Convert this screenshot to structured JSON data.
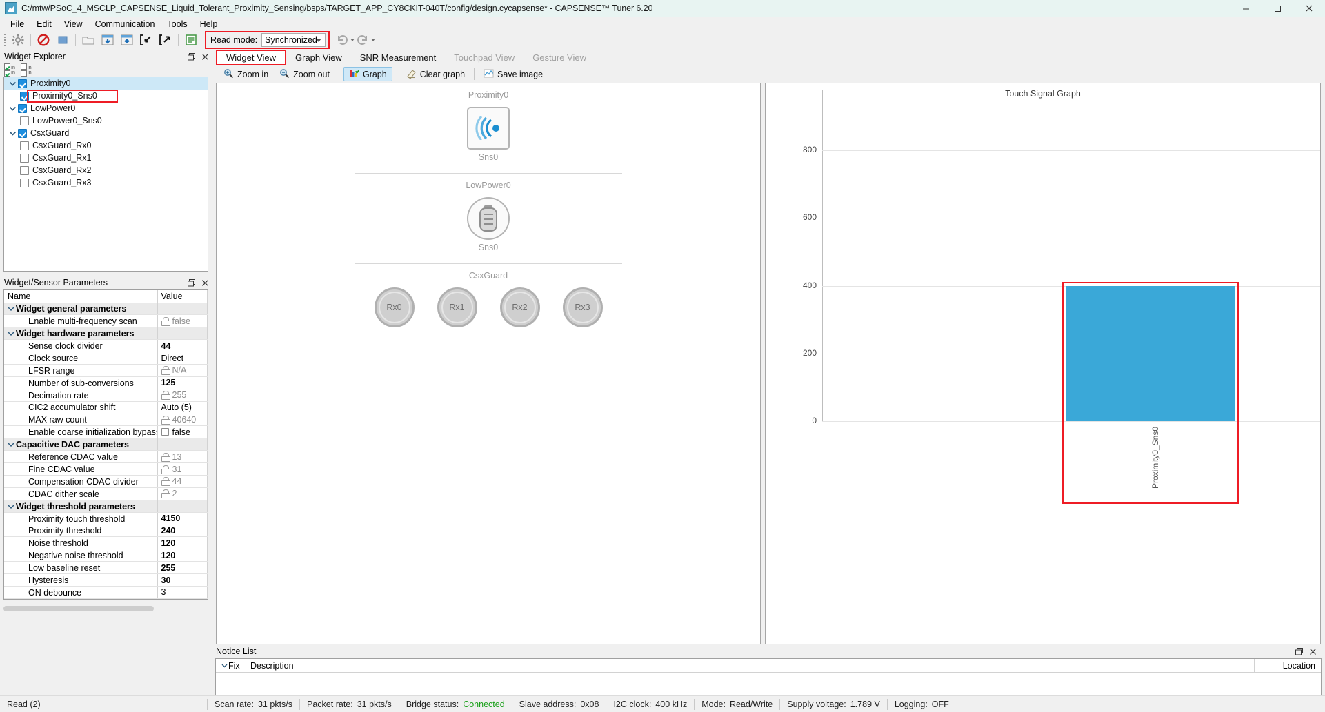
{
  "window": {
    "title": "C:/mtw/PSoC_4_MSCLP_CAPSENSE_Liquid_Tolerant_Proximity_Sensing/bsps/TARGET_APP_CY8CKIT-040T/config/design.cycapsense* - CAPSENSE™ Tuner 6.20",
    "minimize": "–",
    "maximize": "▢",
    "close": "✕"
  },
  "menu": {
    "items": [
      "File",
      "Edit",
      "View",
      "Communication",
      "Tools",
      "Help"
    ]
  },
  "toolbar": {
    "read_mode_label": "Read mode:",
    "read_mode_value": "Synchronized",
    "buttons": [
      "settings-icon",
      "disconnect-icon",
      "stop-icon",
      "open-icon",
      "apply-to-device-icon",
      "apply-to-project-icon",
      "import-icon",
      "export-icon",
      "log-icon"
    ],
    "undo_label": "Undo",
    "redo_label": "Redo"
  },
  "widget_explorer": {
    "title": "Widget Explorer",
    "restore_label": "Restore",
    "close_label": "Close",
    "tree": [
      {
        "label": "Proximity0",
        "level": 0,
        "checked": true,
        "expanded": true,
        "selected": true,
        "highlight": false
      },
      {
        "label": "Proximity0_Sns0",
        "level": 1,
        "checked": true,
        "expanded": null,
        "selected": false,
        "highlight": true
      },
      {
        "label": "LowPower0",
        "level": 0,
        "checked": true,
        "expanded": true,
        "selected": false,
        "highlight": false
      },
      {
        "label": "LowPower0_Sns0",
        "level": 1,
        "checked": false,
        "expanded": null,
        "selected": false,
        "highlight": false
      },
      {
        "label": "CsxGuard",
        "level": 0,
        "checked": true,
        "expanded": true,
        "selected": false,
        "highlight": false
      },
      {
        "label": "CsxGuard_Rx0",
        "level": 1,
        "checked": false,
        "expanded": null,
        "selected": false,
        "highlight": false
      },
      {
        "label": "CsxGuard_Rx1",
        "level": 1,
        "checked": false,
        "expanded": null,
        "selected": false,
        "highlight": false
      },
      {
        "label": "CsxGuard_Rx2",
        "level": 1,
        "checked": false,
        "expanded": null,
        "selected": false,
        "highlight": false
      },
      {
        "label": "CsxGuard_Rx3",
        "level": 1,
        "checked": false,
        "expanded": null,
        "selected": false,
        "highlight": false
      }
    ]
  },
  "parameters": {
    "title": "Widget/Sensor Parameters",
    "columns": [
      "Name",
      "Value"
    ],
    "rows": [
      {
        "kind": "group",
        "name": "Widget general parameters",
        "value": ""
      },
      {
        "kind": "item",
        "name": "Enable multi-frequency scan",
        "value": "false",
        "locked": true,
        "bold": false
      },
      {
        "kind": "group",
        "name": "Widget hardware parameters",
        "value": ""
      },
      {
        "kind": "item",
        "name": "Sense clock divider",
        "value": "44",
        "locked": false,
        "bold": true
      },
      {
        "kind": "item",
        "name": "Clock source",
        "value": "Direct",
        "locked": false,
        "bold": false
      },
      {
        "kind": "item",
        "name": "LFSR range",
        "value": "N/A",
        "locked": true,
        "bold": false
      },
      {
        "kind": "item",
        "name": "Number of sub-conversions",
        "value": "125",
        "locked": false,
        "bold": true
      },
      {
        "kind": "item",
        "name": "Decimation rate",
        "value": "255",
        "locked": true,
        "bold": false
      },
      {
        "kind": "item",
        "name": "CIC2 accumulator shift",
        "value": "Auto (5)",
        "locked": false,
        "bold": false
      },
      {
        "kind": "item",
        "name": "MAX raw count",
        "value": "40640",
        "locked": true,
        "bold": false
      },
      {
        "kind": "item",
        "name": "Enable coarse initialization bypass",
        "value": "false",
        "checkbox": true,
        "locked": false,
        "bold": false
      },
      {
        "kind": "group",
        "name": "Capacitive DAC parameters",
        "value": ""
      },
      {
        "kind": "item",
        "name": "Reference CDAC value",
        "value": "13",
        "locked": true,
        "bold": false
      },
      {
        "kind": "item",
        "name": "Fine CDAC value",
        "value": "31",
        "locked": true,
        "bold": false
      },
      {
        "kind": "item",
        "name": "Compensation CDAC divider",
        "value": "44",
        "locked": true,
        "bold": false
      },
      {
        "kind": "item",
        "name": "CDAC dither scale",
        "value": "2",
        "locked": true,
        "bold": false
      },
      {
        "kind": "group",
        "name": "Widget threshold parameters",
        "value": ""
      },
      {
        "kind": "item",
        "name": "Proximity touch threshold",
        "value": "4150",
        "locked": false,
        "bold": true
      },
      {
        "kind": "item",
        "name": "Proximity threshold",
        "value": "240",
        "locked": false,
        "bold": true
      },
      {
        "kind": "item",
        "name": "Noise threshold",
        "value": "120",
        "locked": false,
        "bold": true
      },
      {
        "kind": "item",
        "name": "Negative noise threshold",
        "value": "120",
        "locked": false,
        "bold": true
      },
      {
        "kind": "item",
        "name": "Low baseline reset",
        "value": "255",
        "locked": false,
        "bold": true
      },
      {
        "kind": "item",
        "name": "Hysteresis",
        "value": "30",
        "locked": false,
        "bold": true
      },
      {
        "kind": "item",
        "name": "ON debounce",
        "value": "3",
        "locked": false,
        "bold": false
      }
    ]
  },
  "tabs": [
    {
      "label": "Widget View",
      "active": true,
      "disabled": false
    },
    {
      "label": "Graph View",
      "active": false,
      "disabled": false
    },
    {
      "label": "SNR Measurement",
      "active": false,
      "disabled": false
    },
    {
      "label": "Touchpad View",
      "active": false,
      "disabled": true
    },
    {
      "label": "Gesture View",
      "active": false,
      "disabled": true
    }
  ],
  "graph_toolbar": [
    {
      "label": "Zoom in",
      "icon": "zoom-in-icon",
      "toggled": false
    },
    {
      "label": "Zoom out",
      "icon": "zoom-out-icon",
      "toggled": false
    },
    {
      "label": "Graph",
      "icon": "graph-icon",
      "toggled": true
    },
    {
      "label": "Clear graph",
      "icon": "clear-graph-icon",
      "toggled": false
    },
    {
      "label": "Save image",
      "icon": "save-image-icon",
      "toggled": false
    }
  ],
  "widget_view": {
    "sections": [
      {
        "title": "Proximity0",
        "icon": "proximity-sensor-icon",
        "sensors": [
          "Sns0"
        ]
      },
      {
        "title": "LowPower0",
        "icon": "battery-icon",
        "sensors": [
          "Sns0"
        ]
      },
      {
        "title": "CsxGuard",
        "icon": "rx-circle-icon",
        "sensors": [
          "Rx0",
          "Rx1",
          "Rx2",
          "Rx3"
        ]
      }
    ]
  },
  "chart_data": {
    "type": "bar",
    "title": "Touch Signal Graph",
    "categories": [
      "Proximity0_Sns0"
    ],
    "values": [
      400
    ],
    "series": [
      {
        "name": "Touch Signal",
        "values": [
          400
        ]
      }
    ],
    "xlabel": "",
    "ylabel": "",
    "ylim": [
      0,
      900
    ],
    "yticks": [
      0,
      200,
      400,
      600,
      800
    ],
    "ytick_labels": [
      "0",
      "200",
      "400",
      "600",
      "800"
    ],
    "grid": true,
    "legend": false,
    "bar_color": "#3aa8d8",
    "highlight_color": "#ee1c25"
  },
  "notice_list": {
    "title": "Notice List",
    "restore_label": "Restore",
    "close_label": "Close",
    "columns": [
      "Fix",
      "Description",
      "Location"
    ],
    "rows": []
  },
  "status_bar": {
    "state": "Read (2)",
    "items": [
      {
        "key": "Scan rate:",
        "value": "31 pkts/s",
        "accent": false
      },
      {
        "key": "Packet rate:",
        "value": "31 pkts/s",
        "accent": false
      },
      {
        "key": "Bridge status:",
        "value": "Connected",
        "accent": true
      },
      {
        "key": "Slave address:",
        "value": "0x08",
        "accent": false
      },
      {
        "key": "I2C clock:",
        "value": "400 kHz",
        "accent": false
      },
      {
        "key": "Mode:",
        "value": "Read/Write",
        "accent": false
      },
      {
        "key": "Supply voltage:",
        "value": "1.789 V",
        "accent": false
      },
      {
        "key": "Logging:",
        "value": "OFF",
        "accent": false
      }
    ]
  }
}
